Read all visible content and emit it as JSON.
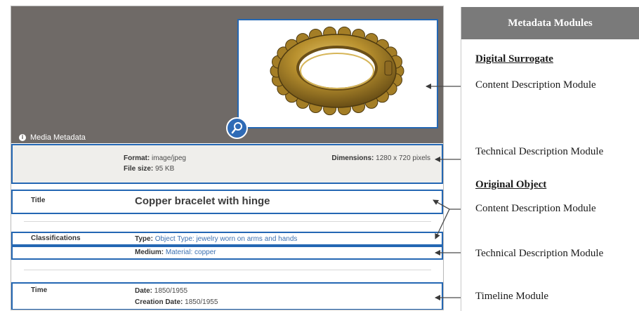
{
  "media_panel": {
    "media_metadata_label": "Media Metadata",
    "info_icon_glyph": "i",
    "format_label": "Format:",
    "format_value": "image/jpeg",
    "file_size_label": "File size:",
    "file_size_value": "95 KB",
    "dimensions_label": "Dimensions:",
    "dimensions_value": "1280 x 720 pixels"
  },
  "object_fields": {
    "title_label": "Title",
    "title_value": "Copper bracelet with hinge",
    "classifications_label": "Classifications",
    "type_label": "Type:",
    "type_value": "Object Type: jewelry worn on arms and hands",
    "medium_label": "Medium:",
    "medium_value": "Material: copper",
    "time_label": "Time",
    "date_label": "Date:",
    "date_value": "1850/1955",
    "creation_date_label": "Creation Date:",
    "creation_date_value": "1850/1955"
  },
  "modules_panel": {
    "header": "Metadata Modules",
    "digital_surrogate": "Digital Surrogate",
    "original_object": "Original Object",
    "content_description_1": "Content Description Module",
    "technical_description_1": "Technical Description Module",
    "content_description_2": "Content Description Module",
    "technical_description_2": "Technical Description Module",
    "timeline": "Timeline Module"
  },
  "colors": {
    "highlight_border": "#2467b3",
    "viewer_background": "#6f6a67",
    "header_background": "#7a7a7a",
    "bracelet_gold": "#b8902e"
  },
  "icons": {
    "zoom": "zoom-in-icon",
    "info": "info-icon",
    "image": "bracelet-image"
  }
}
